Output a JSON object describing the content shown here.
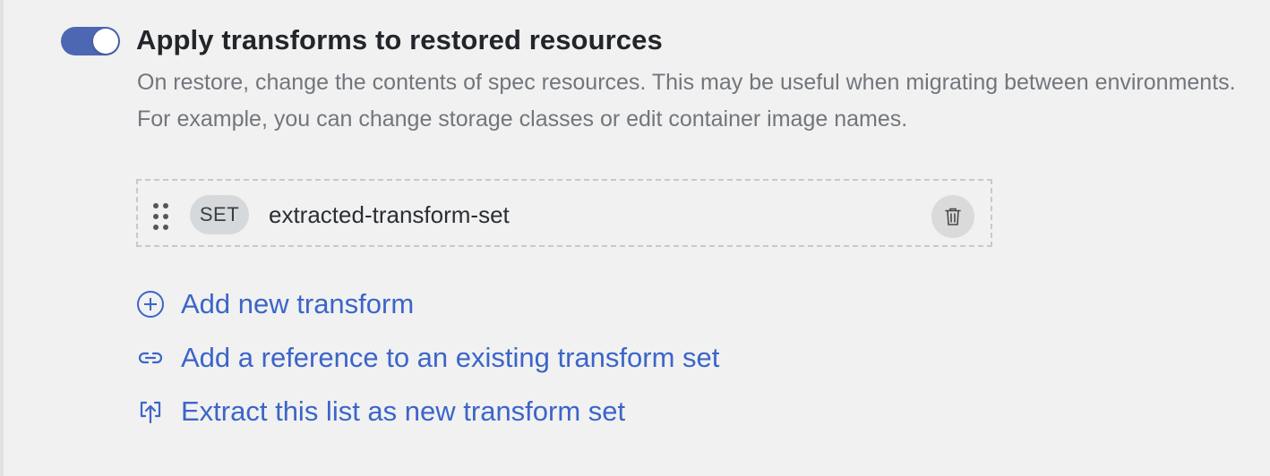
{
  "toggle": {
    "enabled": true,
    "accent_color": "#4e67b3"
  },
  "section": {
    "title": "Apply transforms to restored resources",
    "description": "On restore, change the contents of spec resources. This may be useful when migrating between environments. For example, you can change storage classes or edit container image names."
  },
  "transform_sets": [
    {
      "badge": "SET",
      "name": "extracted-transform-set"
    }
  ],
  "actions": [
    {
      "icon": "plus-circle-icon",
      "label": "Add new transform"
    },
    {
      "icon": "link-icon",
      "label": "Add a reference to an existing transform set"
    },
    {
      "icon": "upload-box-icon",
      "label": "Extract this list as new transform set"
    }
  ],
  "colors": {
    "link": "#3c65c9",
    "background": "#f1f1f1",
    "muted_text": "#72767c"
  }
}
